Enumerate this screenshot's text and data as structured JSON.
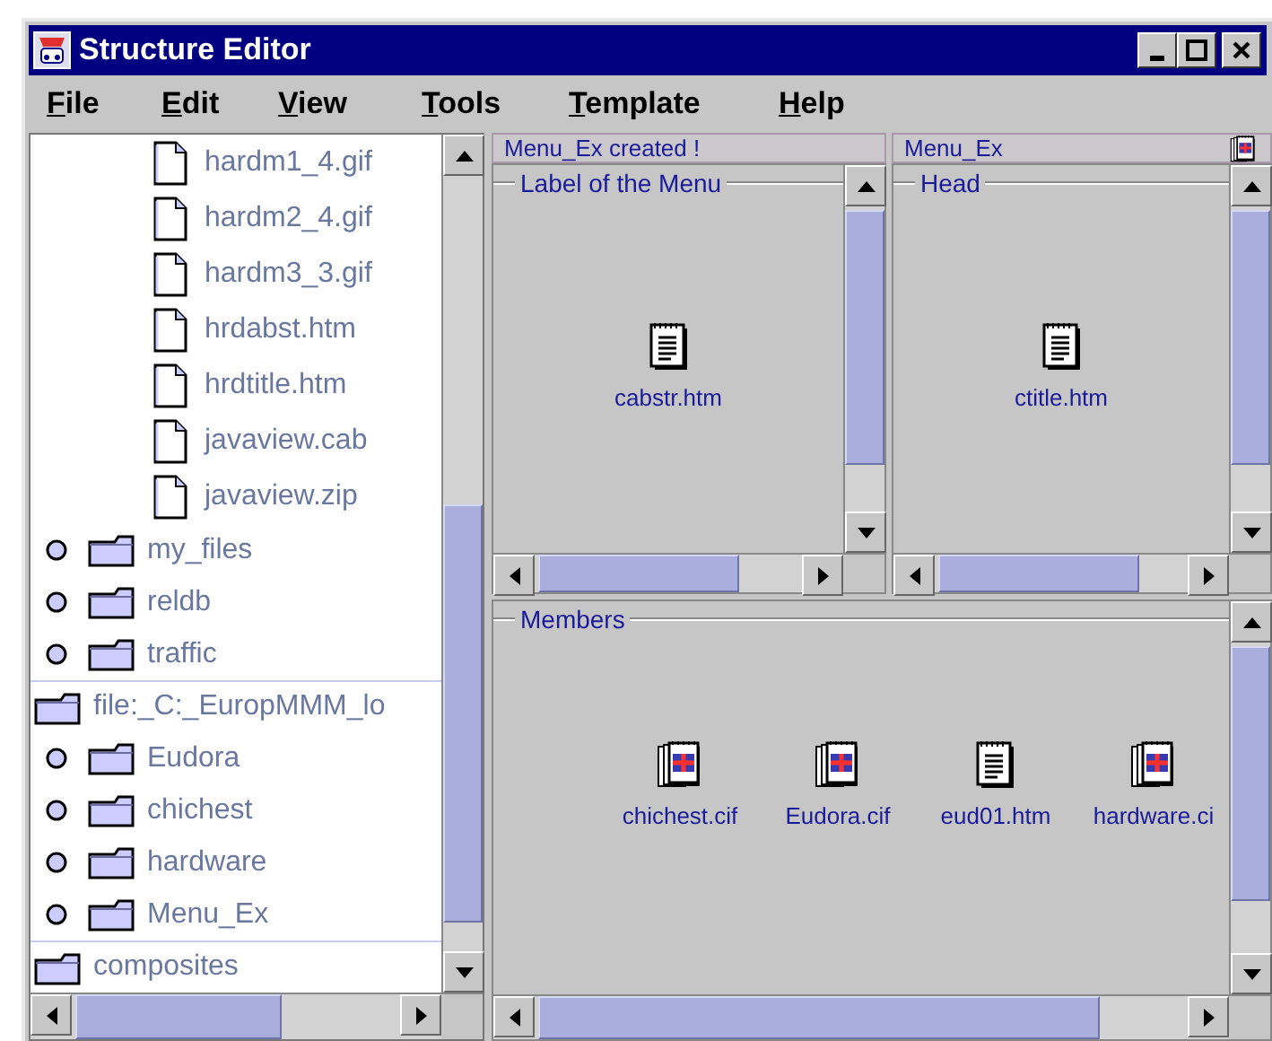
{
  "window": {
    "title": "Structure Editor"
  },
  "menu": [
    "File",
    "Edit",
    "View",
    "Tools",
    "Template",
    "Help"
  ],
  "tree": [
    {
      "children": [
        {
          "children": [
            {
              "label": "hardm1_4.gif",
              "kind": "file"
            },
            {
              "label": "hardm2_4.gif",
              "kind": "file"
            },
            {
              "label": "hardm3_3.gif",
              "kind": "file"
            },
            {
              "label": "hrdabst.htm",
              "kind": "file"
            },
            {
              "label": "hrdtitle.htm",
              "kind": "file"
            },
            {
              "label": "javaview.cab",
              "kind": "file"
            },
            {
              "label": "javaview.zip",
              "kind": "file"
            }
          ]
        },
        {
          "label": "my_files",
          "kind": "folder",
          "expanded": false
        },
        {
          "label": "reldb",
          "kind": "folder",
          "expanded": false
        },
        {
          "label": "traffic",
          "kind": "folder",
          "expanded": false
        }
      ]
    },
    {
      "label": "file:_C:_EuropMMM_lo",
      "kind": "folder",
      "children": [
        {
          "label": "Eudora",
          "kind": "folder",
          "expanded": false
        },
        {
          "label": "chichest",
          "kind": "folder",
          "expanded": false
        },
        {
          "label": "hardware",
          "kind": "folder",
          "expanded": false
        },
        {
          "label": "Menu_Ex",
          "kind": "folder",
          "expanded": false
        }
      ]
    },
    {
      "label": "composites",
      "kind": "folder"
    }
  ],
  "panes": [
    {
      "header": "Menu_Ex created !",
      "group": "Label of the Menu",
      "items": [
        {
          "name": "cabstr.htm",
          "kind": "document"
        }
      ]
    },
    {
      "header": "Menu_Ex",
      "header_icon": true,
      "group": "Head",
      "items": [
        {
          "name": "ctitle.htm",
          "kind": "document"
        }
      ]
    }
  ],
  "members": {
    "group": "Members",
    "items": [
      {
        "name": "chichest.cif",
        "kind": "composite"
      },
      {
        "name": "Eudora.cif",
        "kind": "composite"
      },
      {
        "name": "eud01.htm",
        "kind": "document"
      },
      {
        "name": "hardware.ci",
        "kind": "composite"
      }
    ]
  }
}
